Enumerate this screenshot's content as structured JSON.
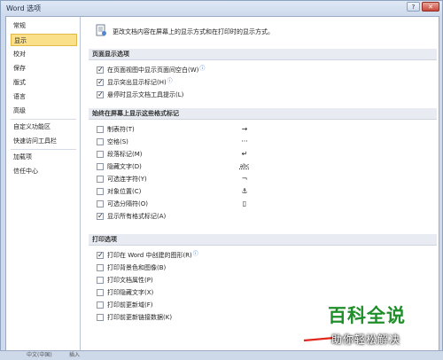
{
  "window": {
    "title": "Word 选项",
    "help_label": "?",
    "close_label": "✕"
  },
  "nav": {
    "items": [
      {
        "label": "常规"
      },
      {
        "label": "显示"
      },
      {
        "label": "校对"
      },
      {
        "label": "保存"
      },
      {
        "label": "版式"
      },
      {
        "label": "语言"
      },
      {
        "label": "高级"
      },
      {
        "label": "自定义功能区"
      },
      {
        "label": "快速访问工具栏"
      },
      {
        "label": "加载项"
      },
      {
        "label": "信任中心"
      }
    ],
    "selected": "显示"
  },
  "intro": {
    "text": "更改文档内容在屏幕上的显示方式和在打印时的显示方式。"
  },
  "sections": {
    "page_display": {
      "title": "页面显示选项",
      "options": [
        {
          "label": "在页面视图中显示页面间空白(W)",
          "checked": true,
          "info": "ⓘ"
        },
        {
          "label": "显示突出显示标记(H)",
          "checked": true,
          "info": "ⓘ"
        },
        {
          "label": "悬停时显示文档工具提示(L)",
          "checked": true
        }
      ]
    },
    "formatting_marks": {
      "title": "始终在屏幕上显示这些格式标记",
      "options": [
        {
          "label": "制表符(T)",
          "checked": false,
          "symbol": "→"
        },
        {
          "label": "空格(S)",
          "checked": false,
          "symbol": "···"
        },
        {
          "label": "段落标记(M)",
          "checked": false,
          "symbol": "↵"
        },
        {
          "label": "隐藏文字(D)",
          "checked": false,
          "symbol": "abc"
        },
        {
          "label": "可选连字符(Y)",
          "checked": false,
          "symbol": "¬"
        },
        {
          "label": "对象位置(C)",
          "checked": false,
          "symbol": "⚓"
        },
        {
          "label": "可选分隔符(O)",
          "checked": false,
          "symbol": "▯"
        },
        {
          "label": "显示所有格式标记(A)",
          "checked": true
        }
      ]
    },
    "print": {
      "title": "打印选项",
      "options": [
        {
          "label": "打印在 Word 中创建的图形(R)",
          "checked": true,
          "info": "ⓘ"
        },
        {
          "label": "打印背景色和图像(B)",
          "checked": false
        },
        {
          "label": "打印文档属性(P)",
          "checked": false
        },
        {
          "label": "打印隐藏文字(X)",
          "checked": false
        },
        {
          "label": "打印前更新域(F)",
          "checked": false
        },
        {
          "label": "打印前更新链接数据(K)",
          "checked": false
        }
      ]
    }
  },
  "taskbar": {
    "tabs": [
      "中文(中国)",
      "插入"
    ]
  },
  "watermark": {
    "top": "百科全说",
    "bottom": "助你轻松解决"
  },
  "colors": {
    "accent_selected": "#fbe08a",
    "watermark_green": "#1f8f2a",
    "info_blue": "#2b6cc4"
  }
}
